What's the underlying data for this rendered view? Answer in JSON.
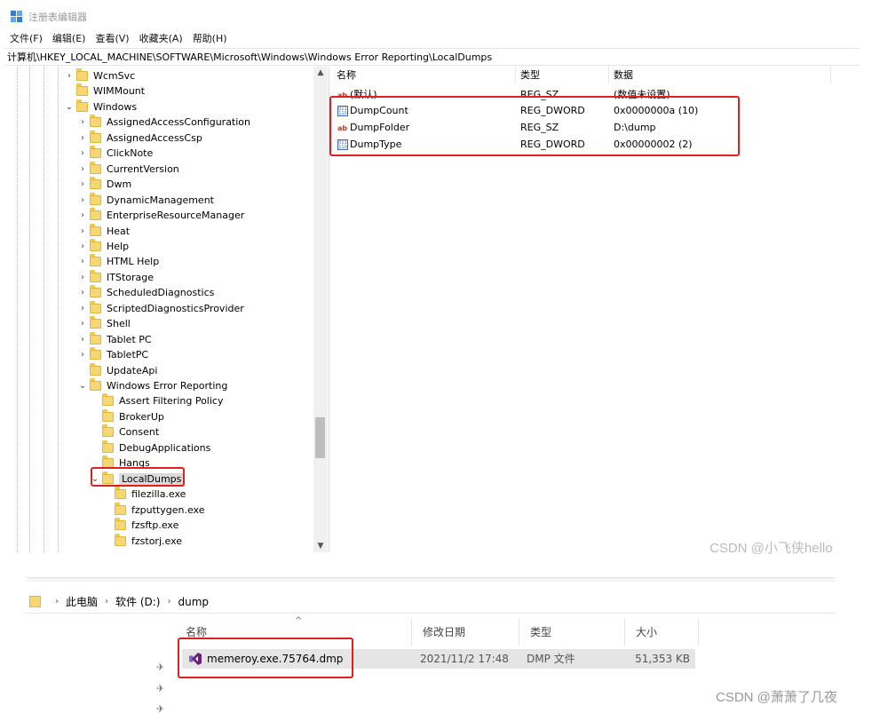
{
  "regedit": {
    "title": "注册表编辑器",
    "menu": [
      "文件(F)",
      "编辑(E)",
      "查看(V)",
      "收藏夹(A)",
      "帮助(H)"
    ],
    "address": "计算机\\HKEY_LOCAL_MACHINE\\SOFTWARE\\Microsoft\\Windows\\Windows Error Reporting\\LocalDumps",
    "tree": [
      {
        "label": "WcmSvc",
        "expander": "collapsed",
        "level": 0
      },
      {
        "label": "WIMMount",
        "expander": "none",
        "level": 0
      },
      {
        "label": "Windows",
        "expander": "expanded",
        "level": 0
      },
      {
        "label": "AssignedAccessConfiguration",
        "expander": "collapsed",
        "level": 1
      },
      {
        "label": "AssignedAccessCsp",
        "expander": "collapsed",
        "level": 1
      },
      {
        "label": "ClickNote",
        "expander": "collapsed",
        "level": 1
      },
      {
        "label": "CurrentVersion",
        "expander": "collapsed",
        "level": 1
      },
      {
        "label": "Dwm",
        "expander": "collapsed",
        "level": 1
      },
      {
        "label": "DynamicManagement",
        "expander": "collapsed",
        "level": 1
      },
      {
        "label": "EnterpriseResourceManager",
        "expander": "collapsed",
        "level": 1
      },
      {
        "label": "Heat",
        "expander": "collapsed",
        "level": 1
      },
      {
        "label": "Help",
        "expander": "collapsed",
        "level": 1
      },
      {
        "label": "HTML Help",
        "expander": "collapsed",
        "level": 1
      },
      {
        "label": "ITStorage",
        "expander": "collapsed",
        "level": 1
      },
      {
        "label": "ScheduledDiagnostics",
        "expander": "collapsed",
        "level": 1
      },
      {
        "label": "ScriptedDiagnosticsProvider",
        "expander": "collapsed",
        "level": 1
      },
      {
        "label": "Shell",
        "expander": "collapsed",
        "level": 1
      },
      {
        "label": "Tablet PC",
        "expander": "collapsed",
        "level": 1
      },
      {
        "label": "TabletPC",
        "expander": "collapsed",
        "level": 1
      },
      {
        "label": "UpdateApi",
        "expander": "none",
        "level": 1
      },
      {
        "label": "Windows Error Reporting",
        "expander": "expanded",
        "level": 1
      },
      {
        "label": "Assert Filtering Policy",
        "expander": "none",
        "level": 2
      },
      {
        "label": "BrokerUp",
        "expander": "none",
        "level": 2
      },
      {
        "label": "Consent",
        "expander": "none",
        "level": 2
      },
      {
        "label": "DebugApplications",
        "expander": "none",
        "level": 2
      },
      {
        "label": "Hangs",
        "expander": "none",
        "level": 2
      },
      {
        "label": "LocalDumps",
        "expander": "expanded",
        "level": 2,
        "selected": true
      },
      {
        "label": "filezilla.exe",
        "expander": "none",
        "level": 3
      },
      {
        "label": "fzputtygen.exe",
        "expander": "none",
        "level": 3
      },
      {
        "label": "fzsftp.exe",
        "expander": "none",
        "level": 3
      },
      {
        "label": "fzstorj.exe",
        "expander": "none",
        "level": 3
      }
    ],
    "columns": {
      "name": "名称",
      "type": "类型",
      "data": "数据"
    },
    "values": [
      {
        "icon": "string-value-icon",
        "name": "(默认)",
        "type": "REG_SZ",
        "data": "(数值未设置)"
      },
      {
        "icon": "dword-value-icon",
        "name": "DumpCount",
        "type": "REG_DWORD",
        "data": "0x0000000a (10)"
      },
      {
        "icon": "string-value-icon",
        "name": "DumpFolder",
        "type": "REG_SZ",
        "data": "D:\\dump"
      },
      {
        "icon": "dword-value-icon",
        "name": "DumpType",
        "type": "REG_DWORD",
        "data": "0x00000002 (2)"
      }
    ],
    "watermark": "CSDN @小飞侠hello"
  },
  "explorer": {
    "breadcrumb": [
      "此电脑",
      "软件 (D:)",
      "dump"
    ],
    "columns": {
      "name": "名称",
      "modified": "修改日期",
      "type": "类型",
      "size": "大小"
    },
    "files": [
      {
        "name": "memeroy.exe.75764.dmp",
        "modified": "2021/11/2 17:48",
        "type": "DMP 文件",
        "size": "51,353 KB"
      }
    ],
    "watermark": "CSDN @萧萧了几夜"
  },
  "colors": {
    "highlight": "#e02020",
    "folder": "#f7d774",
    "selection": "#e5e5e5"
  }
}
